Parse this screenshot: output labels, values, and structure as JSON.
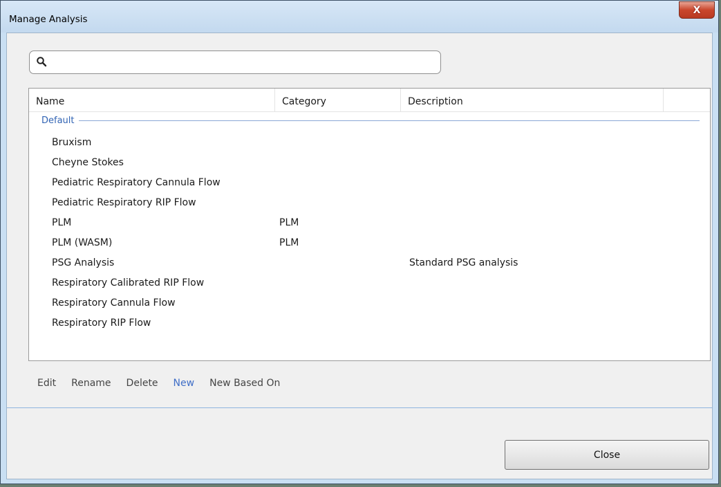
{
  "window": {
    "title": "Manage Analysis",
    "close_glyph": "X"
  },
  "search": {
    "icon": "search-icon",
    "value": "",
    "placeholder": ""
  },
  "list": {
    "columns": [
      "Name",
      "Category",
      "Description"
    ],
    "group_label": "Default",
    "rows": [
      {
        "name": "Bruxism",
        "category": "",
        "description": ""
      },
      {
        "name": "Cheyne Stokes",
        "category": "",
        "description": ""
      },
      {
        "name": "Pediatric Respiratory Cannula Flow",
        "category": "",
        "description": ""
      },
      {
        "name": "Pediatric Respiratory RIP Flow",
        "category": "",
        "description": ""
      },
      {
        "name": "PLM",
        "category": "PLM",
        "description": ""
      },
      {
        "name": "PLM (WASM)",
        "category": "PLM",
        "description": ""
      },
      {
        "name": "PSG Analysis",
        "category": "",
        "description": "Standard PSG analysis"
      },
      {
        "name": "Respiratory Calibrated RIP Flow",
        "category": "",
        "description": ""
      },
      {
        "name": "Respiratory Cannula Flow",
        "category": "",
        "description": ""
      },
      {
        "name": "Respiratory RIP Flow",
        "category": "",
        "description": ""
      }
    ]
  },
  "actions": {
    "edit": "Edit",
    "rename": "Rename",
    "delete": "Delete",
    "new": "New",
    "new_based_on": "New Based On"
  },
  "footer": {
    "close_label": "Close"
  },
  "colors": {
    "accent_link": "#3f6ec7",
    "group_label": "#3264b4",
    "window_frame": "#c9dff3"
  }
}
